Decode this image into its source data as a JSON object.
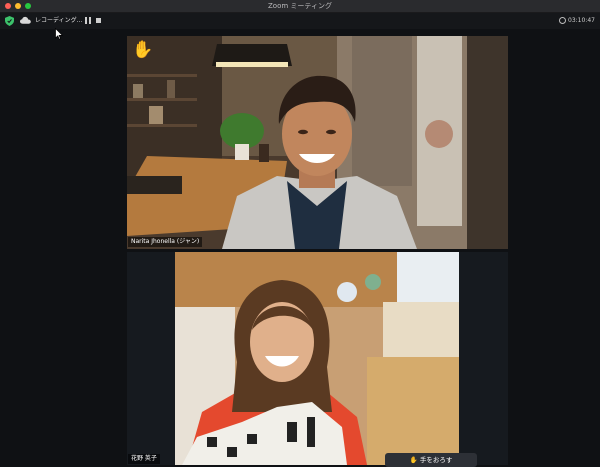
{
  "window": {
    "title": "Zoom ミーティング"
  },
  "toolbar": {
    "recording_label": "レコーディング...",
    "timer": "03:10:47"
  },
  "participants": [
    {
      "name": "Narita Jhonella (ジャン)",
      "raised_hand": true
    },
    {
      "name": "花野 英子"
    }
  ],
  "controls": {
    "lower_hand_label": "手をおろす"
  },
  "icons": {
    "security": "shield-icon",
    "recording": "cloud-recording-icon",
    "pause": "pause-icon",
    "stop": "stop-icon",
    "timer": "clock-icon",
    "raised_hand": "raised-hand-icon"
  },
  "colors": {
    "security_shield": "#3cc26b",
    "close": "#ff5f57",
    "minimize": "#febc2e",
    "maximize": "#28c840"
  }
}
